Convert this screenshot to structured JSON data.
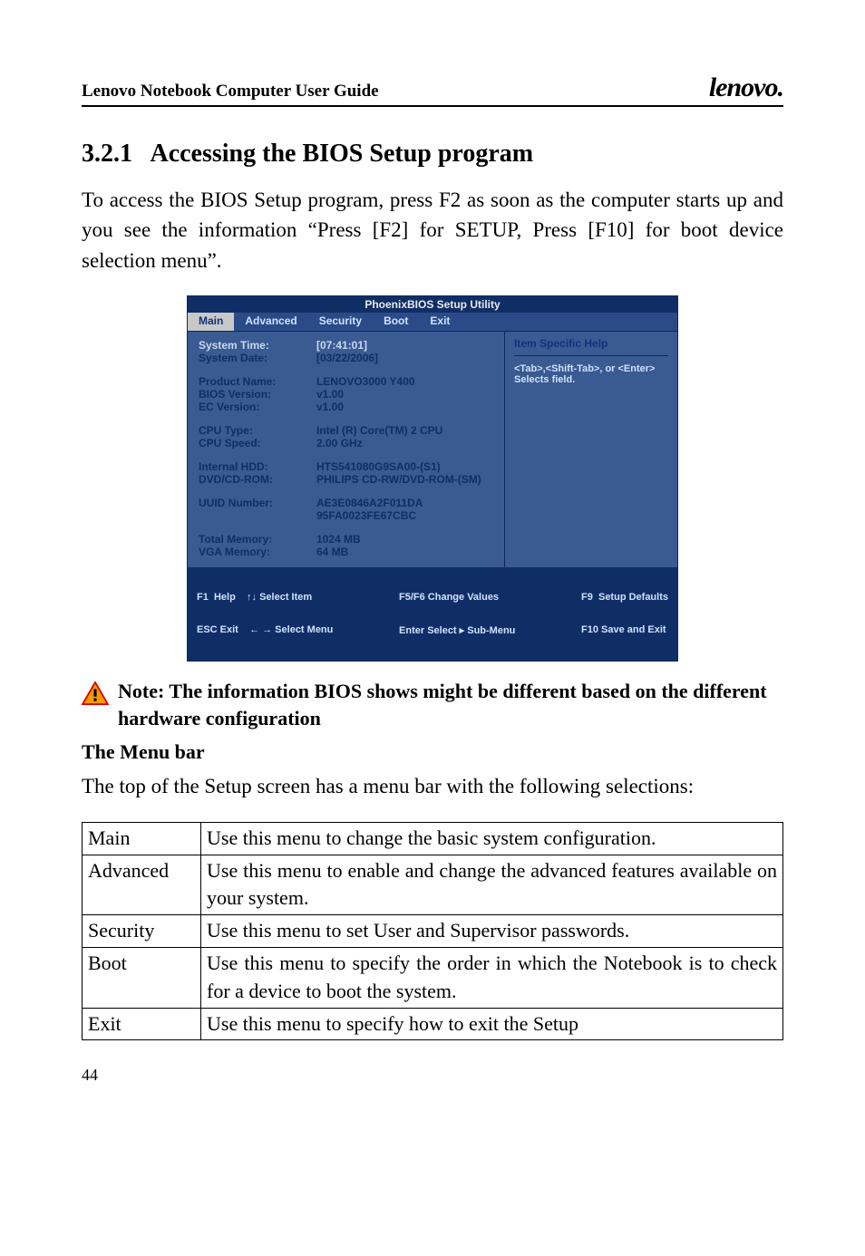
{
  "header": {
    "doc_title": "Lenovo Notebook Computer User Guide",
    "brand": "lenovo."
  },
  "section": {
    "number": "3.2.1",
    "title": "Accessing the BIOS Setup program"
  },
  "intro_para": "To access the BIOS Setup program, press F2 as soon as the computer starts up and you see the information “Press [F2] for SETUP, Press [F10] for boot device selection menu”.",
  "bios": {
    "title": "PhoenixBIOS Setup Utility",
    "tabs": [
      "Main",
      "Advanced",
      "Security",
      "Boot",
      "Exit"
    ],
    "active_tab": "Main",
    "fields": {
      "system_time_label": "System Time:",
      "system_time_value": "[07:41:01]",
      "system_date_label": "System Date:",
      "system_date_value": "[03/22/2006]",
      "product_name_label": "Product Name:",
      "product_name_value": "LENOVO3000 Y400",
      "bios_version_label": "BIOS Version:",
      "bios_version_value": "v1.00",
      "ec_version_label": "EC    Version:",
      "ec_version_value": "v1.00",
      "cpu_type_label": "CPU Type:",
      "cpu_type_value": "Intel (R) Core(TM) 2 CPU",
      "cpu_speed_label": "CPU Speed:",
      "cpu_speed_value": "2.00 GHz",
      "internal_hdd_label": "Internal HDD:",
      "internal_hdd_value": "HTS541080G9SA00-(S1)",
      "dvd_label": "DVD/CD-ROM:",
      "dvd_value": "PHILIPS CD-RW/DVD-ROM-(SM)",
      "uuid_label": "UUID Number:",
      "uuid_value_1": "AE3E0846A2F011DA",
      "uuid_value_2": "95FA0023FE67CBC",
      "total_mem_label": "Total Memory:",
      "total_mem_value": "1024 MB",
      "vga_mem_label": "VGA  Memory:",
      "vga_mem_value": "64 MB"
    },
    "help": {
      "title": "Item Specific Help",
      "text": "<Tab>,<Shift-Tab>, or <Enter> Selects field."
    },
    "footer": {
      "col1": "F1  Help    ↑↓ Select Item",
      "col1b": "ESC Exit    ← → Select Menu",
      "col2": "F5/F6 Change Values",
      "col2b": "Enter Select ▸ Sub-Menu",
      "col3": "F9  Setup Defaults",
      "col3b": "F10 Save and Exit"
    }
  },
  "note": "Note: The information BIOS shows might be different based on the different hardware configuration",
  "menu_bar_heading": "The Menu bar",
  "menu_bar_intro": "The top of the Setup screen has a menu bar with the following selections:",
  "menu_table": [
    {
      "name": "Main",
      "desc": "Use this menu to change the basic system configuration."
    },
    {
      "name": "Advanced",
      "desc": "Use this menu to enable and change the advanced features available on your system."
    },
    {
      "name": "Security",
      "desc": "Use this menu to set User and Supervisor passwords."
    },
    {
      "name": "Boot",
      "desc": "Use this menu to specify the order in which the Notebook is to check for a device to boot the system."
    },
    {
      "name": "Exit",
      "desc": "Use this menu to specify how to exit the Setup"
    }
  ],
  "page_number": "44"
}
